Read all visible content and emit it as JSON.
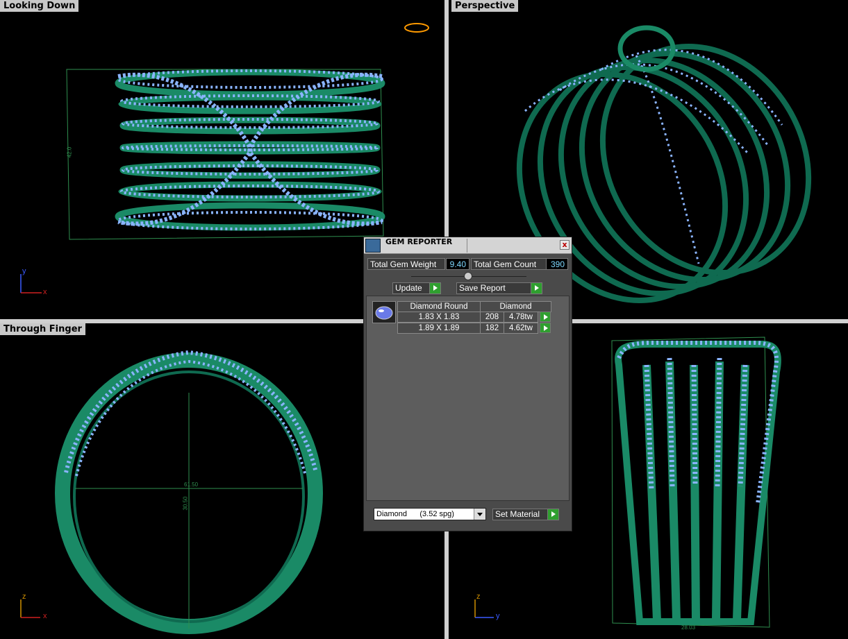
{
  "viewports": {
    "top_left": {
      "label": "Looking Down",
      "dim_label": "42.0",
      "axis": {
        "v": "y",
        "h": "x"
      }
    },
    "top_right": {
      "label": "Perspective"
    },
    "bottom_left": {
      "label": "Through Finger",
      "dim_h": "61.50",
      "dim_v": "30.50",
      "axis": {
        "v": "z",
        "h": "x"
      }
    },
    "bottom_right": {
      "label": "",
      "dim_label": "28.03",
      "axis": {
        "v": "z",
        "h": "y"
      }
    }
  },
  "gem_reporter": {
    "title": "GEM REPORTER",
    "close_label": "x",
    "total_weight_label": "Total Gem Weight",
    "total_weight_value": "9.40",
    "total_count_label": "Total Gem Count",
    "total_count_value": "390",
    "update_label": "Update",
    "save_report_label": "Save Report",
    "table": {
      "header_cut": "Diamond Round",
      "header_material": "Diamond",
      "rows": [
        {
          "size": "1.83 X 1.83",
          "count": "208",
          "weight": "4.78tw"
        },
        {
          "size": "1.89 X 1.89",
          "count": "182",
          "weight": "4.62tw"
        }
      ]
    },
    "material_select": "Diamond      (3.52 spg)",
    "set_material_label": "Set Material"
  },
  "colors": {
    "metal": "#1a8a66",
    "gem": "#8ab4ff",
    "dim": "#2f8f4f"
  }
}
